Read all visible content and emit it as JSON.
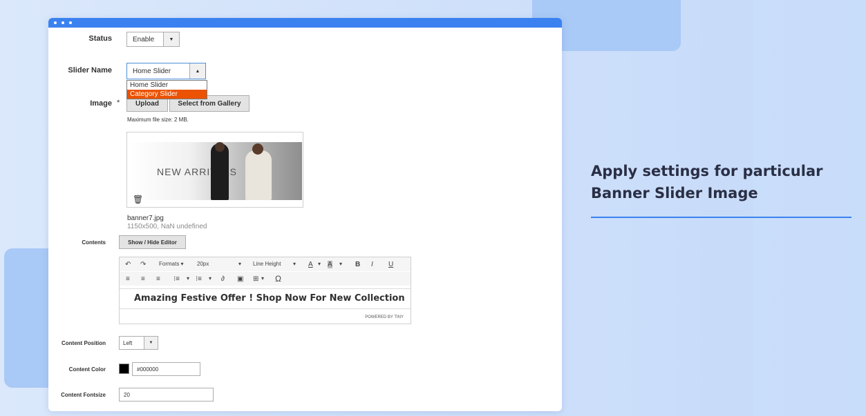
{
  "form": {
    "status": {
      "label": "Status",
      "value": "Enable"
    },
    "slider_name": {
      "label": "Slider Name",
      "value": "Home Slider",
      "options": [
        "Home Slider",
        "Category Slider"
      ]
    },
    "image": {
      "label": "Image",
      "required_mark": "*",
      "upload_label": "Upload",
      "gallery_label": "Select from Gallery",
      "max_size_note": "Maximum file size: 2 MB.",
      "banner_text": "NEW ARRIVALS",
      "file_name": "banner7.jpg",
      "file_meta": "1150x500, NaN undefined"
    },
    "contents": {
      "label": "Contents",
      "toggle_label": "Show / Hide Editor",
      "toolbar": {
        "formats": "Formats ▾",
        "font_size": "20px",
        "line_height": "Line Height"
      },
      "text": "Amazing Festive Offer ! Shop Now For New Collection",
      "powered_by": "POWERED BY TINY"
    },
    "content_position": {
      "label": "Content Position",
      "value": "Left"
    },
    "content_color": {
      "label": "Content Color",
      "value": "#000000",
      "swatch": "#000000"
    },
    "content_fontsize": {
      "label": "Content Fontsize",
      "value": "20"
    }
  },
  "side": {
    "title": "Apply settings for particular Banner Slider Image"
  },
  "colors": {
    "accent": "#3b82f0",
    "selected_option": "#eb5202"
  }
}
